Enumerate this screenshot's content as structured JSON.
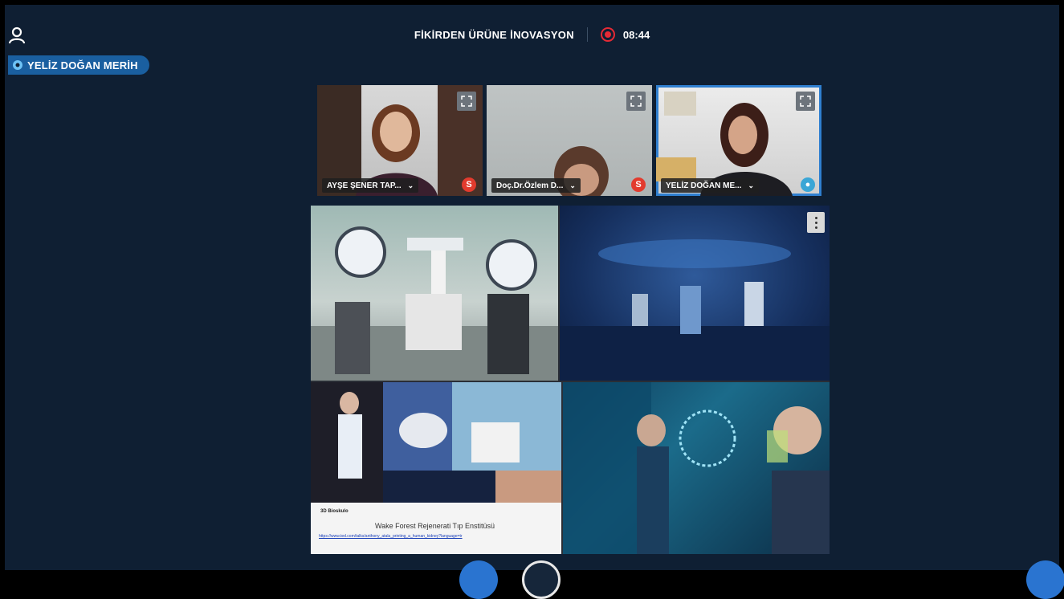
{
  "header": {
    "meeting_title": "FİKİRDEN ÜRÜNE İNOVASYON",
    "recording_time": "08:44"
  },
  "presenter": {
    "name": "YELİZ DOĞAN MERİH"
  },
  "participants": [
    {
      "name": "AYŞE ŞENER TAP...",
      "status": "presenter-mic-off"
    },
    {
      "name": "Doç.Dr.Özlem D...",
      "status": "mic-off"
    },
    {
      "name": "YELİZ DOĞAN ME...",
      "status": "moderator"
    }
  ],
  "shared_screen": {
    "doc_heading": "3D Bioskulo",
    "doc_text": "Wake Forest Rejenerati Tıp Enstitüsü",
    "doc_link": "https://www.ted.com/talks/anthony_atala_printing_a_human_kidney?language=tr"
  },
  "colors": {
    "background": "#0f1f33",
    "accent": "#2a74d0",
    "recording": "#e52a35",
    "active_speaker_outline": "#2f7fd0"
  }
}
